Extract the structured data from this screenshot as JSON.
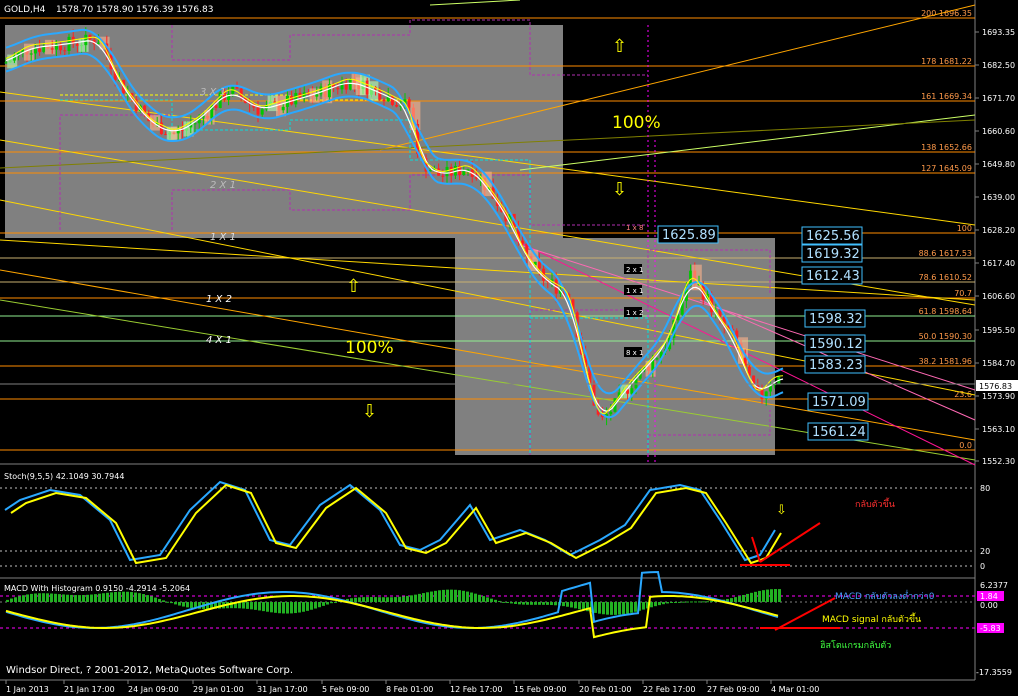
{
  "header": {
    "symbol": "GOLD,H4",
    "ohlc": "1578.70 1578.90 1576.39 1576.83"
  },
  "price_axis": {
    "ticks": [
      "1693.35",
      "1682.50",
      "1671.70",
      "1660.60",
      "1649.80",
      "1639.00",
      "1628.20",
      "1617.40",
      "1606.60",
      "1595.50",
      "1584.70",
      "1573.90",
      "1563.10",
      "1552.30"
    ],
    "current_price": "1576.83"
  },
  "time_axis": [
    "1 Jan 2013",
    "21 Jan 17:00",
    "24 Jan 09:00",
    "29 Jan 01:00",
    "31 Jan 17:00",
    "5 Feb 09:00",
    "8 Feb 01:00",
    "12 Feb 17:00",
    "15 Feb 09:00",
    "20 Feb 01:00",
    "22 Feb 17:00",
    "27 Feb 09:00",
    "4 Mar 01:00"
  ],
  "fib_levels": [
    "200  1696.35",
    "178  1681.22",
    "161  1669.34",
    "138  1652.66",
    "127  1645.09",
    "100",
    "88.6  1617.53",
    "78.6  1610.52",
    "70.7",
    "61.8  1598.64",
    "50.0  1590.30",
    "38.2  1581.96",
    "23.6",
    "0.0"
  ],
  "gann_labels": [
    "1 x 8",
    "2 x 1",
    "1 x 1",
    "1 x 2",
    "8 x 1",
    "2 X 1",
    "1 X 1",
    "1 X 2",
    "4 X 1",
    "3 X 1"
  ],
  "price_boxes": [
    "1625.89",
    "1625.56",
    "1619.32",
    "1612.43",
    "1598.32",
    "1590.12",
    "1583.23",
    "1571.09",
    "1561.24"
  ],
  "big_labels": [
    "100%",
    "100%"
  ],
  "arrows": [
    "⇧",
    "⇩",
    "⇧",
    "⇩",
    "⇩"
  ],
  "stoch": {
    "label": "Stoch(9,5,5) 42.1049 30.7944",
    "levels": [
      "80",
      "20",
      "0"
    ],
    "note": "กลับตัวขึ้น"
  },
  "macd": {
    "label": "MACD With Histogram  0.9150 -4.2914 -5.2064",
    "levels": [
      "6.2377",
      "0.00",
      "-17.3559"
    ],
    "box_top": "1.84",
    "box_bottom": "-5.83",
    "note1": "MACD กลับตัวลงต่ำกว่า0",
    "note2": "MACD signal กลับตัวขึ้น",
    "note3": "ฮิสโตแกรมกลับตัว"
  },
  "copyright": "Windsor Direct, ? 2001-2012, MetaQuotes Software Corp.",
  "colors": {
    "bull": "#00c800",
    "bear": "#ff0000",
    "ma_blue": "#2aa8ff",
    "ma_yellow": "#ffff00",
    "band": "#808080"
  }
}
